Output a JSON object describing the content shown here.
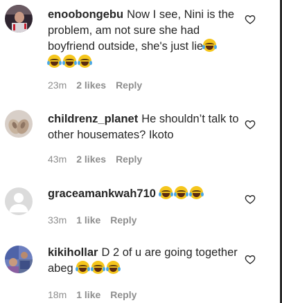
{
  "comments": [
    {
      "username": "enoobongebu",
      "text": "Now I see, Nini is the problem, am not sure she had boyfriend outside, she's just lie",
      "emoji_count": 4,
      "time": "23m",
      "likes": "2 likes",
      "reply": "Reply"
    },
    {
      "username": "childrenz_planet",
      "text": "He shouldn’t talk to other housemates? Ikoto",
      "emoji_count": 0,
      "time": "43m",
      "likes": "2 likes",
      "reply": "Reply"
    },
    {
      "username": "graceamankwah710",
      "text": "",
      "emoji_count": 3,
      "time": "33m",
      "likes": "1 like",
      "reply": "Reply"
    },
    {
      "username": "kikihollar",
      "text": "D 2 of u are going together abeg",
      "emoji_count": 3,
      "time": "18m",
      "likes": "1 like",
      "reply": "Reply"
    }
  ],
  "icons": {
    "like": "heart-outline-icon",
    "emoji": "face-with-tears-of-joy-icon"
  },
  "colors": {
    "text": "#262626",
    "meta": "#8e8e8e",
    "emoji": "#f5c61d"
  }
}
